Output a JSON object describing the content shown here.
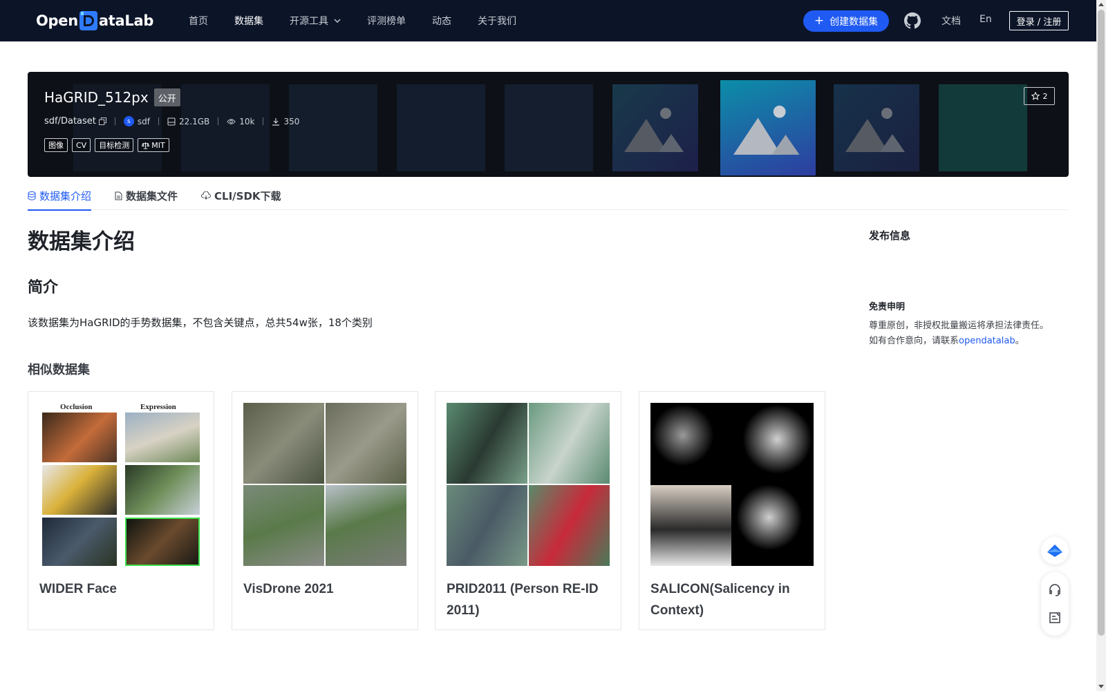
{
  "header": {
    "logo_text_left": "Open",
    "logo_text_right": "ataLab",
    "nav": [
      "首页",
      "数据集",
      "开源工具",
      "评测榜单",
      "动态",
      "关于我们"
    ],
    "active_nav": "数据集",
    "create_label": "创建数据集",
    "docs_label": "文档",
    "lang_label": "En",
    "login_label": "登录 / 注册"
  },
  "dataset": {
    "name": "HaGRID_512px",
    "visibility": "公开",
    "path": "sdf/Dataset",
    "author_initial": "s",
    "author": "sdf",
    "size": "22.1GB",
    "views": "10k",
    "downloads": "350",
    "tags": [
      "图像",
      "CV",
      "目标检测"
    ],
    "license": "MIT",
    "stars": "2"
  },
  "tabs": [
    "数据集介绍",
    "数据集文件",
    "CLI/SDK下载"
  ],
  "content": {
    "title": "数据集介绍",
    "section": "简介",
    "description": "该数据集为HaGRID的手势数据集，不包含关键点，总共54w张，18个类别",
    "similar_title": "相似数据集",
    "similar": [
      {
        "name": "WIDER Face",
        "labels": [
          "Occlusion",
          "Expression"
        ]
      },
      {
        "name": "VisDrone 2021",
        "labels": []
      },
      {
        "name": "PRID2011 (Person RE-ID 2011)",
        "labels": []
      },
      {
        "name": "SALICON(Salicency in Context)",
        "labels": []
      }
    ]
  },
  "sidebar": {
    "publish_title": "发布信息",
    "disclaimer_title": "免责申明",
    "disclaimer_line1": "尊重原创，非授权批量搬运将承担法律责任。",
    "disclaimer_line2_prefix": "如有合作意向，请联系",
    "disclaimer_link": "opendatalab",
    "disclaimer_line2_suffix": "。"
  },
  "colors": {
    "nav_bg": "#0c1528",
    "accent": "#1f5af2",
    "hero_bg": "#0d1016"
  }
}
